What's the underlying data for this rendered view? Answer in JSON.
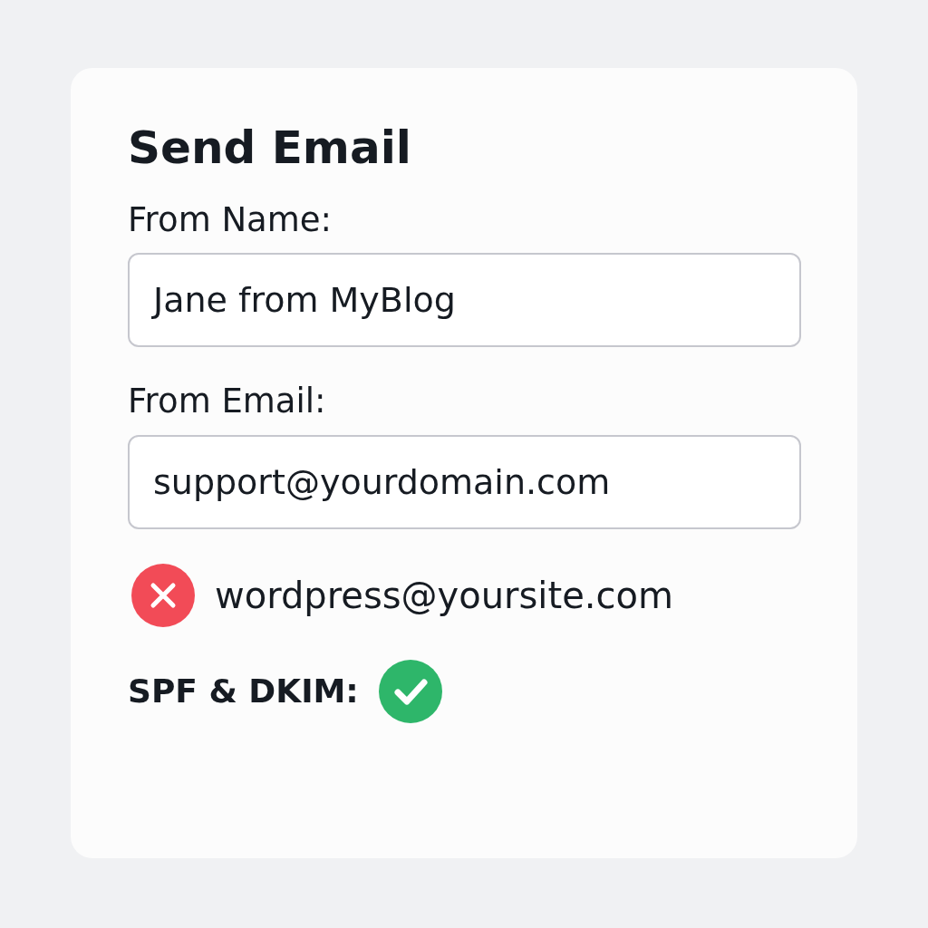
{
  "title": "Send Email",
  "fields": [
    {
      "label": "From Name:",
      "value": "Jane from MyBlog"
    },
    {
      "label": "From Email:",
      "value": "support@yourdomain.com"
    }
  ],
  "sender_check": {
    "ok": false,
    "text": "wordpress@yoursite.com"
  },
  "auth_check": {
    "label": "SPF & DKIM:",
    "ok": true
  }
}
